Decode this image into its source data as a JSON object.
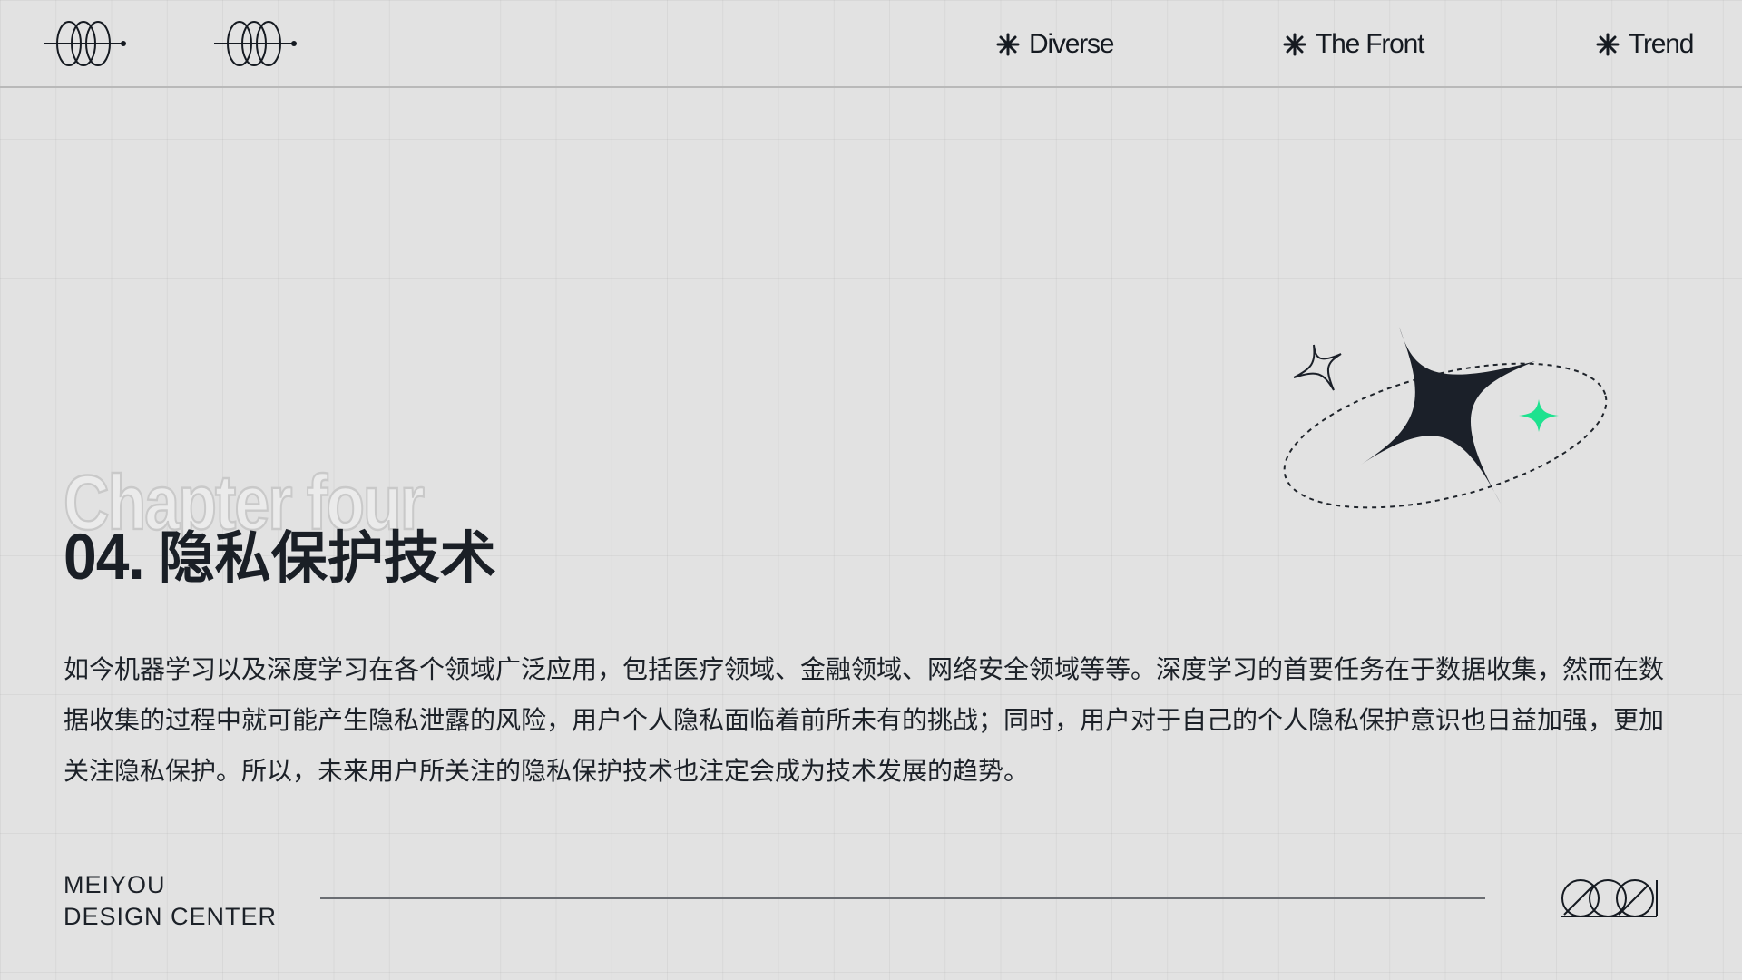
{
  "header": {
    "nav": [
      {
        "label": "Diverse"
      },
      {
        "label": "The Front"
      },
      {
        "label": "Trend"
      }
    ]
  },
  "section": {
    "background_label": "Chapter four",
    "number": "04",
    "dot": ".",
    "title": "隐私保护技术"
  },
  "body": {
    "paragraph": "如今机器学习以及深度学习在各个领域广泛应用，包括医疗领域、金融领域、网络安全领域等等。深度学习的首要任务在于数据收集，然而在数据收集的过程中就可能产生隐私泄露的风险，用户个人隐私面临着前所未有的挑战；同时，用户对于自己的个人隐私保护意识也日益加强，更加关注隐私保护。所以，未来用户所关注的隐私保护技术也注定会成为技术发展的趋势。"
  },
  "footer": {
    "brand_line1": "MEIYOU",
    "brand_line2": "DESIGN CENTER"
  },
  "colors": {
    "background": "#e2e2e2",
    "text": "#1a1f26",
    "accent": "#1de28f"
  },
  "icons": [
    "ring-logo-icon",
    "asterisk-star-icon",
    "four-point-star-icon",
    "circles-logo-icon"
  ]
}
